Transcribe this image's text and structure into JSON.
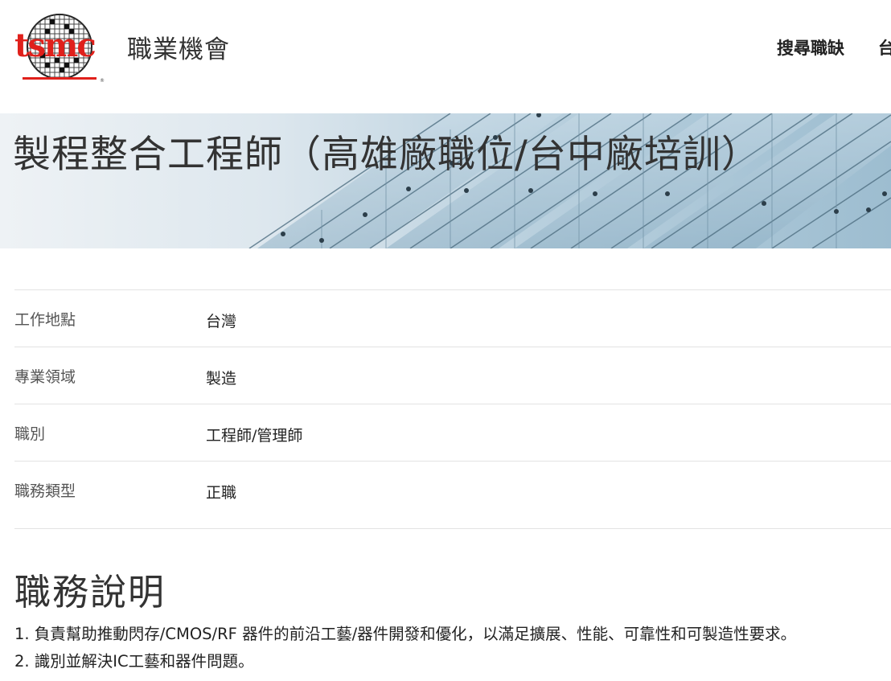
{
  "header": {
    "logo_text": "tsmc",
    "site_title": "職業機會",
    "nav": {
      "search_jobs": "搜尋職缺",
      "region": "台"
    }
  },
  "banner": {
    "job_title": "製程整合工程師（高雄廠職位/台中廠培訓）"
  },
  "job_info": [
    {
      "label": "工作地點",
      "value": "台灣"
    },
    {
      "label": "專業領域",
      "value": "製造"
    },
    {
      "label": "職別",
      "value": "工程師/管理師"
    },
    {
      "label": "職務類型",
      "value": "正職"
    }
  ],
  "description": {
    "title": "職務說明",
    "items": [
      "1. 負責幫助推動閃存/CMOS/RF 器件的前沿工藝/器件開發和優化，以滿足擴展、性能、可靠性和可製造性要求。",
      "2. 識別並解決IC工藝和器件問題。"
    ]
  },
  "colors": {
    "brand_red": "#e0201b",
    "text_dark": "#333333",
    "divider": "#e3e3e3"
  }
}
